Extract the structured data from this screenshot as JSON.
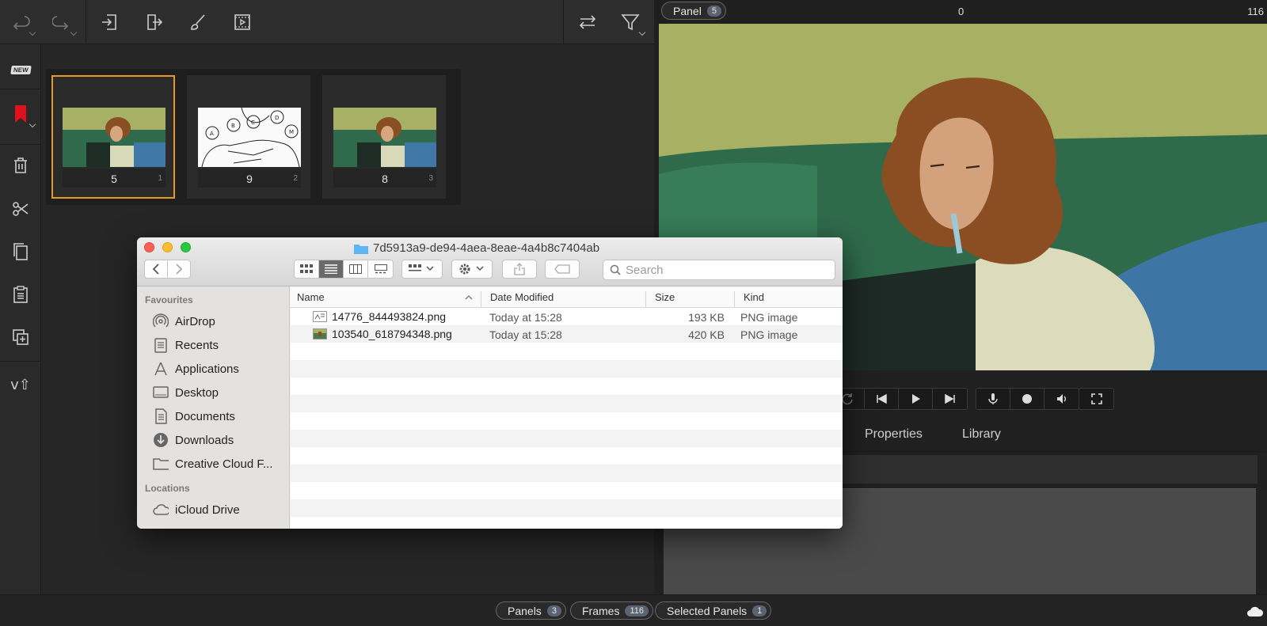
{
  "toolbar": {
    "buttons": [
      "undo-icon",
      "redo-icon",
      "import-icon",
      "export-icon",
      "brush-icon",
      "storyboard-play-icon",
      "swap-icon",
      "filter-icon"
    ]
  },
  "left_rail": {
    "new_badge": "NEW",
    "icons": [
      "new-panel-icon",
      "bookmark-icon",
      "trash-icon",
      "scissors-icon",
      "copy-icon",
      "paste-icon",
      "duplicate-icon",
      "version-up-icon"
    ],
    "version_label": "v⇧"
  },
  "panels": [
    {
      "number": "5",
      "index": "1",
      "selected": true,
      "kind": "color"
    },
    {
      "number": "9",
      "index": "2",
      "selected": false,
      "kind": "sketch"
    },
    {
      "number": "8",
      "index": "3",
      "selected": false,
      "kind": "color"
    }
  ],
  "viewer": {
    "panel_label": "Panel",
    "panel_badge": "5",
    "frame_start": "0",
    "frame_end": "116"
  },
  "transport": {
    "icons": [
      "loop-icon",
      "skip-back-icon",
      "play-icon",
      "skip-forward-icon",
      "mic-icon",
      "record-icon",
      "volume-icon",
      "fullscreen-icon"
    ]
  },
  "tabs": [
    "Properties",
    "Library"
  ],
  "status": {
    "panels_label": "Panels",
    "panels_count": "3",
    "frames_label": "Frames",
    "frames_count": "116",
    "selected_label": "Selected Panels",
    "selected_count": "1"
  },
  "finder": {
    "title": "7d5913a9-de94-4aea-8eae-4a4b8c7404ab",
    "search_placeholder": "Search",
    "sidebar": {
      "favourites_label": "Favourites",
      "favourites": [
        {
          "label": "AirDrop",
          "icon": "airdrop-icon"
        },
        {
          "label": "Recents",
          "icon": "recents-icon"
        },
        {
          "label": "Applications",
          "icon": "applications-icon"
        },
        {
          "label": "Desktop",
          "icon": "desktop-icon"
        },
        {
          "label": "Documents",
          "icon": "documents-icon"
        },
        {
          "label": "Downloads",
          "icon": "downloads-icon"
        },
        {
          "label": "Creative Cloud F...",
          "icon": "folder-icon"
        }
      ],
      "locations_label": "Locations",
      "locations": [
        {
          "label": "iCloud Drive",
          "icon": "cloud-icon"
        }
      ]
    },
    "columns": [
      "Name",
      "Date Modified",
      "Size",
      "Kind"
    ],
    "files": [
      {
        "name": "14776_844493824.png",
        "date": "Today at 15:28",
        "size": "193 KB",
        "kind": "PNG image"
      },
      {
        "name": "103540_618794348.png",
        "date": "Today at 15:28",
        "size": "420 KB",
        "kind": "PNG image"
      }
    ]
  },
  "colors": {
    "selection": "#e69a1d",
    "close": "#fc5f57",
    "minimize": "#fdbc2e",
    "zoom": "#28c840",
    "bookmark": "#e0101e"
  }
}
